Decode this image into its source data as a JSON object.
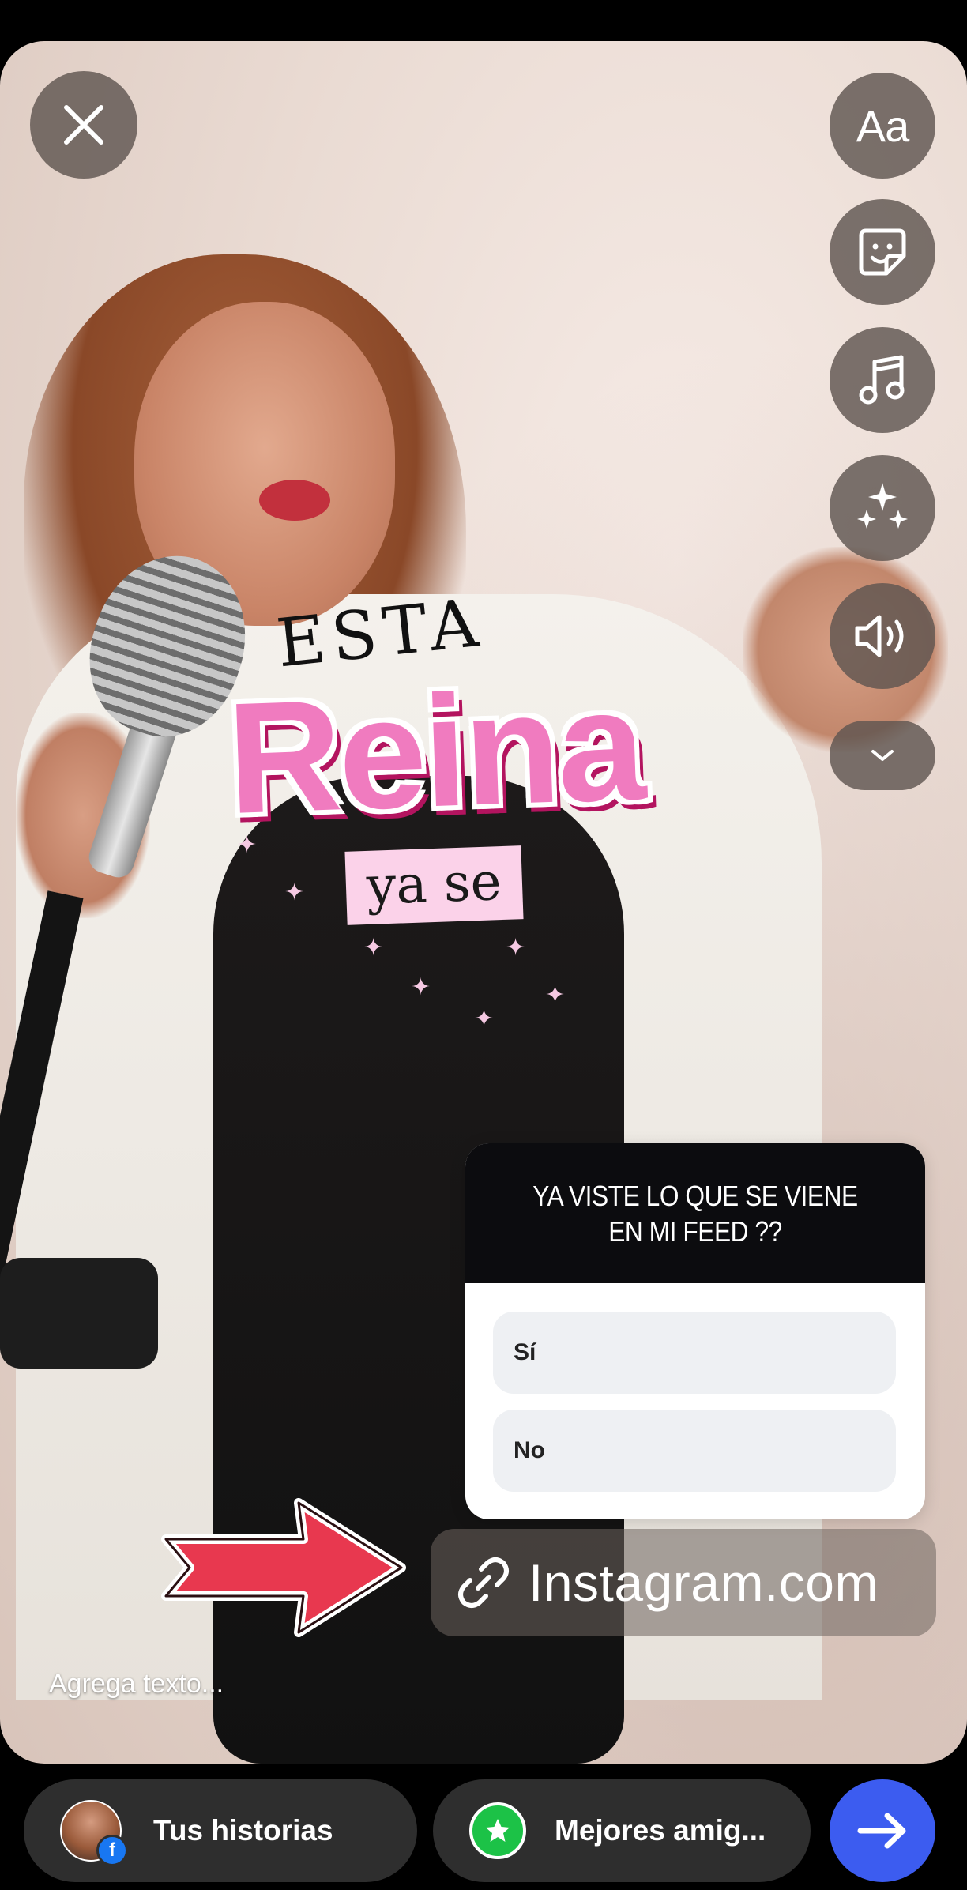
{
  "top_controls": {
    "close_icon": "close-icon",
    "text_tool_label": "Aa",
    "tools": [
      "text-icon",
      "sticker-icon",
      "music-icon",
      "effects-icon",
      "sound-icon",
      "chevron-down-icon"
    ]
  },
  "overlay": {
    "esta": "ESTA",
    "reina": "Reina",
    "yase": "ya se"
  },
  "poll": {
    "question": "YA VISTE LO QUE SE VIENE EN MI FEED ??",
    "options": [
      "Sí",
      "No"
    ]
  },
  "link_sticker": {
    "label": "Instagram.com",
    "icon": "link-icon"
  },
  "caption_placeholder": "Agrega texto...",
  "bottom_bar": {
    "your_story_label": "Tus historias",
    "close_friends_label": "Mejores amig...",
    "avatar_badge": "f",
    "send_icon": "arrow-right-icon"
  },
  "colors": {
    "send_button": "#3c5cf0",
    "close_friends_badge": "#1cc247",
    "reina_pink": "#f07bbf",
    "arrow_red": "#e8384f"
  }
}
